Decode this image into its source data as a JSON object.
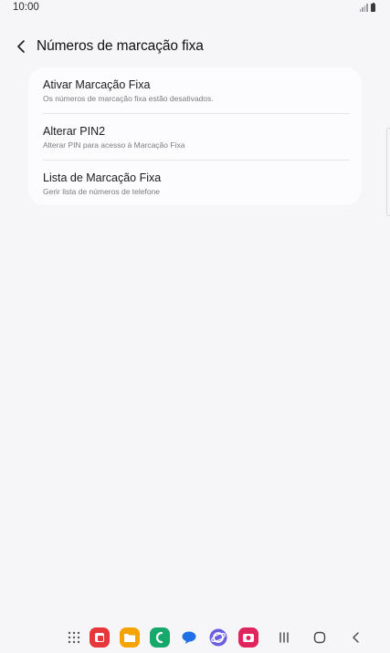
{
  "status_bar": {
    "time": "10:00",
    "icons": [
      "signal-icon",
      "battery-icon"
    ]
  },
  "header": {
    "back_icon": "chevron-left-icon",
    "title": "Números de marcação fixa"
  },
  "settings": [
    {
      "title": "Ativar Marcação Fixa",
      "subtitle": "Os números de marcação fixa estão desativados."
    },
    {
      "title": "Alterar PIN2",
      "subtitle": "Alterar PIN para acesso à Marcação Fixa"
    },
    {
      "title": "Lista de Marcação Fixa",
      "subtitle": "Gerir lista de números de telefone"
    }
  ],
  "nav_bar": {
    "apps": [
      {
        "name": "apps-grid-icon"
      },
      {
        "name": "app-red-icon",
        "color": "#e8373b"
      },
      {
        "name": "app-files-icon",
        "color": "#f5a300"
      },
      {
        "name": "app-phone-icon",
        "color": "#17a86b"
      },
      {
        "name": "app-messages-icon",
        "color": "#1f6fe5"
      },
      {
        "name": "app-internet-icon",
        "color": "#6b5ee0"
      },
      {
        "name": "app-camera-icon",
        "color": "#e0245e"
      }
    ],
    "system": [
      "recents-icon",
      "home-icon",
      "back-icon"
    ]
  }
}
